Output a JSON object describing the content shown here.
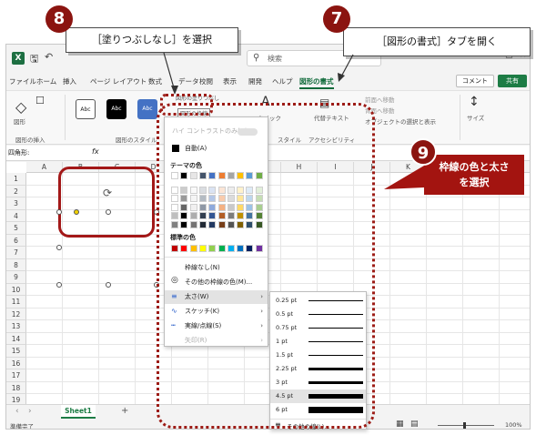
{
  "title_bar": {
    "logo": "X",
    "search_placeholder": "検索"
  },
  "tabs": [
    "ファイル",
    "ホーム",
    "挿入",
    "ページ レイアウト",
    "数式",
    "データ",
    "校閲",
    "表示",
    "開発",
    "ヘルプ",
    "図形の書式"
  ],
  "active_tab": "図形の書式",
  "header_buttons": {
    "comment": "コメント",
    "share": "共有"
  },
  "ribbon": {
    "group_insert": "図形の挿入",
    "group_style": "図形のスタイル",
    "style_samples": [
      "Abc",
      "Abc",
      "Abc"
    ],
    "shape_label": "図形",
    "fill_button": "図形の塗りつぶし",
    "outline_button": "図形の枠線",
    "quick_style": "クイック",
    "alt_text": "代替テキスト",
    "arrange_front": "前面へ移動",
    "arrange_back": "背面へ移動",
    "selection_pane": "オブジェクトの選択と表示",
    "size": "サイズ",
    "textstyle_label": "スタイル",
    "accessibility": "アクセシビリティ"
  },
  "formula_bar": {
    "name_box": "四角形:",
    "fx": "fx"
  },
  "columns": [
    "A",
    "B",
    "C",
    "D",
    "E",
    "F",
    "G",
    "H",
    "I",
    "J",
    "K",
    "L",
    "M",
    "N"
  ],
  "rows": [
    "1",
    "2",
    "3",
    "4",
    "5",
    "6",
    "7",
    "8",
    "9",
    "10",
    "11",
    "12",
    "13",
    "14",
    "15",
    "16",
    "17",
    "18",
    "19"
  ],
  "dropdown": {
    "high_contrast": "ハイ コントラストのみ(H)",
    "auto": "自動(A)",
    "theme_colors": "テーマの色",
    "standard_colors": "標準の色",
    "no_line": "枠線なし(N)",
    "more_colors": "その他の枠線の色(M)...",
    "weight": "太さ(W)",
    "sketch": "スケッチ(K)",
    "dash": "実線/点線(S)",
    "arrows": "矢印(R)",
    "theme_palette": [
      "#ffffff",
      "#000000",
      "#e7e6e6",
      "#44546a",
      "#4472c4",
      "#ed7d31",
      "#a5a5a5",
      "#ffc000",
      "#5b9bd5",
      "#70ad47"
    ],
    "standard_palette": [
      "#c00000",
      "#ff0000",
      "#ffc000",
      "#ffff00",
      "#92d050",
      "#00b050",
      "#00b0f0",
      "#0070c0",
      "#002060",
      "#7030a0"
    ]
  },
  "weights": [
    {
      "label": "0.25 pt",
      "w": 0.25
    },
    {
      "label": "0.5 pt",
      "w": 0.5
    },
    {
      "label": "0.75 pt",
      "w": 0.75
    },
    {
      "label": "1 pt",
      "w": 1
    },
    {
      "label": "1.5 pt",
      "w": 1.5
    },
    {
      "label": "2.25 pt",
      "w": 2.25
    },
    {
      "label": "3 pt",
      "w": 3
    },
    {
      "label": "4.5 pt",
      "w": 4.5
    },
    {
      "label": "6 pt",
      "w": 6
    }
  ],
  "selected_weight": "4.5 pt",
  "more_lines": "その他の線(L)...",
  "sheet": {
    "tab": "Sheet1",
    "add": "+"
  },
  "status": {
    "ready": "準備完了",
    "zoom": "100%"
  },
  "annotations": {
    "step7_num": "7",
    "step7_text": "［図形の書式］タブを開く",
    "step8_num": "8",
    "step8_text": "［塗りつぶしなし］を選択",
    "step9_num": "9",
    "step9_text_1": "枠線の色と太さ",
    "step9_text_2": "を選択"
  },
  "colors": {
    "accent": "#1d7c45",
    "annotation": "#8b1410",
    "shape_border": "#a31818"
  }
}
